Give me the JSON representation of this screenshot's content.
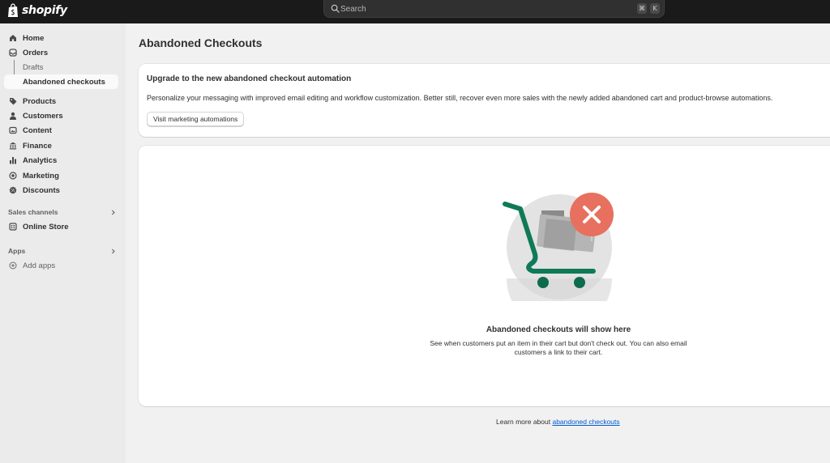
{
  "topbar": {
    "brand": "shopify",
    "search_placeholder": "Search",
    "shortcut_cmd": "⌘",
    "shortcut_key": "K"
  },
  "sidebar": {
    "items": [
      {
        "label": "Home",
        "icon": "home-icon"
      },
      {
        "label": "Orders",
        "icon": "orders-icon"
      },
      {
        "label": "Drafts"
      },
      {
        "label": "Abandoned checkouts"
      },
      {
        "label": "Products",
        "icon": "tag-icon"
      },
      {
        "label": "Customers",
        "icon": "person-icon"
      },
      {
        "label": "Content",
        "icon": "content-icon"
      },
      {
        "label": "Finance",
        "icon": "bank-icon"
      },
      {
        "label": "Analytics",
        "icon": "bar-chart-icon"
      },
      {
        "label": "Marketing",
        "icon": "target-icon"
      },
      {
        "label": "Discounts",
        "icon": "discount-icon"
      }
    ],
    "sales_channels_label": "Sales channels",
    "online_store_label": "Online Store",
    "apps_label": "Apps",
    "add_apps_label": "Add apps"
  },
  "main": {
    "title": "Abandoned Checkouts",
    "promo": {
      "title": "Upgrade to the new abandoned checkout automation",
      "text": "Personalize your messaging with improved email editing and workflow customization. Better still, recover even more sales with the newly added abandoned cart and product-browse automations.",
      "button": "Visit marketing automations"
    },
    "empty": {
      "title": "Abandoned checkouts will show here",
      "desc": "See when customers put an item in their cart but don't check out. You can also email customers a link to their cart."
    },
    "learn_prefix": "Learn more about ",
    "learn_link": "abandoned checkouts"
  },
  "colors": {
    "topbar": "#1a1a1a",
    "accent_green": "#0f7a58",
    "error_red": "#e8705e",
    "link": "#005bd3"
  }
}
